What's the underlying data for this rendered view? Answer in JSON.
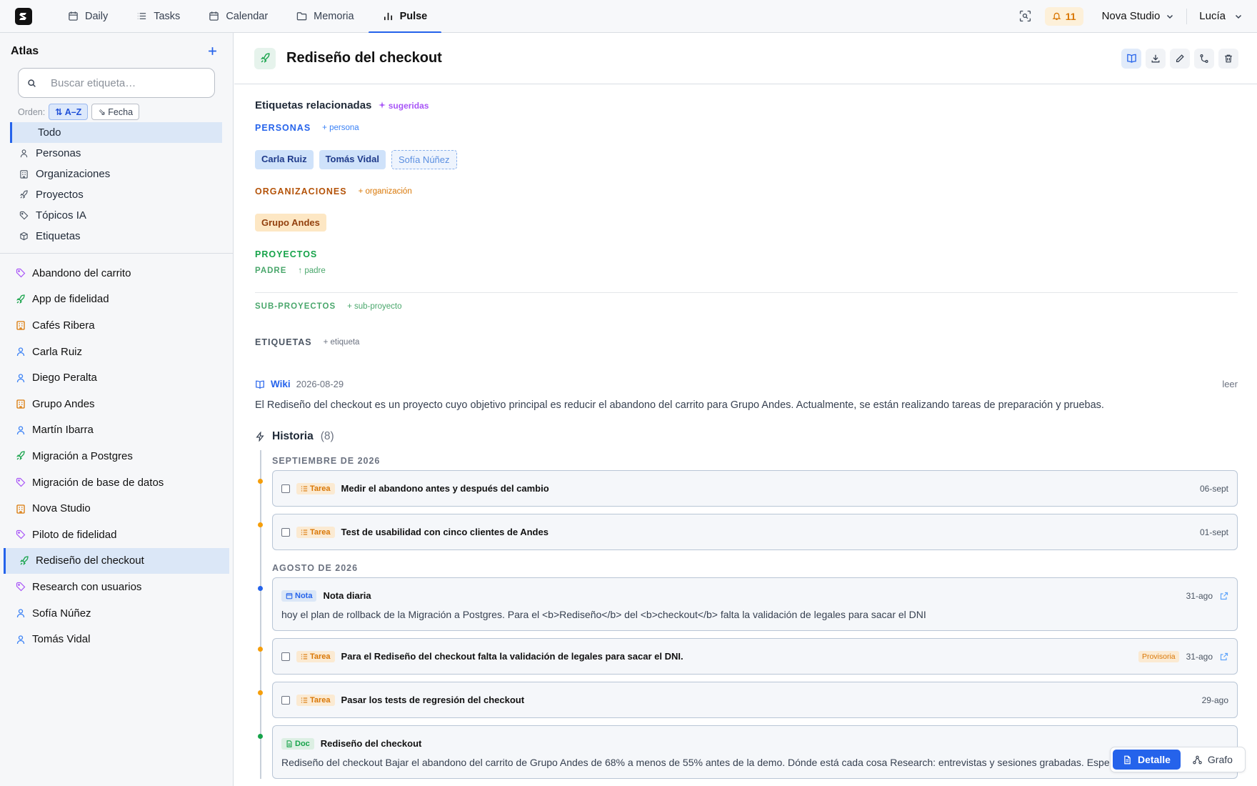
{
  "nav": {
    "tabs": [
      {
        "label": "Daily",
        "icon": "calendar-icon"
      },
      {
        "label": "Tasks",
        "icon": "list-icon"
      },
      {
        "label": "Calendar",
        "icon": "calendar-icon"
      },
      {
        "label": "Memoria",
        "icon": "folder-icon"
      },
      {
        "label": "Pulse",
        "icon": "bar-chart-icon",
        "active": true
      }
    ],
    "notifications": "11",
    "workspace": "Nova Studio",
    "user": "Lucía"
  },
  "sidebar": {
    "title": "Atlas",
    "search_placeholder": "Buscar etiqueta…",
    "order_label": "Orden:",
    "order_az": "A–Z",
    "order_date": "Fecha",
    "categories": [
      "Todo",
      "Personas",
      "Organizaciones",
      "Proyectos",
      "Tópicos IA",
      "Etiquetas"
    ],
    "items": [
      {
        "label": "Abandono del carrito",
        "kind": "tag"
      },
      {
        "label": "App de fidelidad",
        "kind": "project"
      },
      {
        "label": "Cafés Ribera",
        "kind": "org"
      },
      {
        "label": "Carla Ruiz",
        "kind": "person"
      },
      {
        "label": "Diego Peralta",
        "kind": "person"
      },
      {
        "label": "Grupo Andes",
        "kind": "org"
      },
      {
        "label": "Martín Ibarra",
        "kind": "person"
      },
      {
        "label": "Migración a Postgres",
        "kind": "project"
      },
      {
        "label": "Migración de base de datos",
        "kind": "tag"
      },
      {
        "label": "Nova Studio",
        "kind": "org"
      },
      {
        "label": "Piloto de fidelidad",
        "kind": "tag"
      },
      {
        "label": "Rediseño del checkout",
        "kind": "project",
        "active": true
      },
      {
        "label": "Research con usuarios",
        "kind": "tag"
      },
      {
        "label": "Sofía Núñez",
        "kind": "person"
      },
      {
        "label": "Tomás Vidal",
        "kind": "person"
      }
    ]
  },
  "main": {
    "title": "Rediseño del checkout",
    "related_title": "Etiquetas relacionadas",
    "suggested": "sugeridas",
    "personas": {
      "label": "PERSONAS",
      "add": "+ persona",
      "items": [
        "Carla Ruiz",
        "Tomás Vidal"
      ],
      "suggested_item": "Sofía Núñez"
    },
    "orgs": {
      "label": "ORGANIZACIONES",
      "add": "+ organización",
      "items": [
        "Grupo Andes"
      ]
    },
    "projects": {
      "label": "PROYECTOS",
      "parent_label": "PADRE",
      "parent_add": "↑ padre",
      "sub_label": "SUB-PROYECTOS",
      "sub_add": "+ sub-proyecto"
    },
    "etiquetas": {
      "label": "ETIQUETAS",
      "add": "+ etiqueta"
    },
    "wiki": {
      "label": "Wiki",
      "date": "2026-08-29",
      "read": "leer",
      "text": "El Rediseño del checkout es un proyecto cuyo objetivo principal es reducir el abandono del carrito para Grupo Andes. Actualmente, se están realizando tareas de preparación y pruebas."
    },
    "history": {
      "title": "Historia",
      "count": "(8)",
      "months": [
        {
          "label": "SEPTIEMBRE DE 2026",
          "entries": [
            {
              "type": "Tarea",
              "title": "Medir el abandono antes y después del cambio",
              "date": "06-sept"
            },
            {
              "type": "Tarea",
              "title": "Test de usabilidad con cinco clientes de Andes",
              "date": "01-sept"
            }
          ]
        },
        {
          "label": "AGOSTO DE 2026",
          "entries": [
            {
              "type": "Nota",
              "title": "Nota diaria",
              "date": "31-ago",
              "body": "hoy el plan de rollback de la Migración a Postgres. Para el <b>Rediseño</b> del <b>checkout</b> falta la validación de legales para sacar el DNI"
            },
            {
              "type": "Tarea",
              "title": "Para el Rediseño del checkout falta la validación de legales para sacar el DNI.",
              "date": "31-ago",
              "badge": "Provisoria"
            },
            {
              "type": "Tarea",
              "title": "Pasar los tests de regresión del checkout",
              "date": "29-ago"
            },
            {
              "type": "Doc",
              "title": "Rediseño del checkout",
              "body": "Rediseño del checkout Bajar el abandono del carrito de Grupo Andes de 68% a menos de 55% antes de la demo. Dónde está cada cosa Research: entrevistas y sesiones grabadas. Especific"
            }
          ]
        }
      ]
    },
    "view_detail": "Detalle",
    "view_graph": "Grafo"
  },
  "colors": {
    "accent": "#2563eb",
    "person": "#3b82f6",
    "org": "#d97706",
    "project": "#16a34a",
    "tag": "#a855f7"
  }
}
